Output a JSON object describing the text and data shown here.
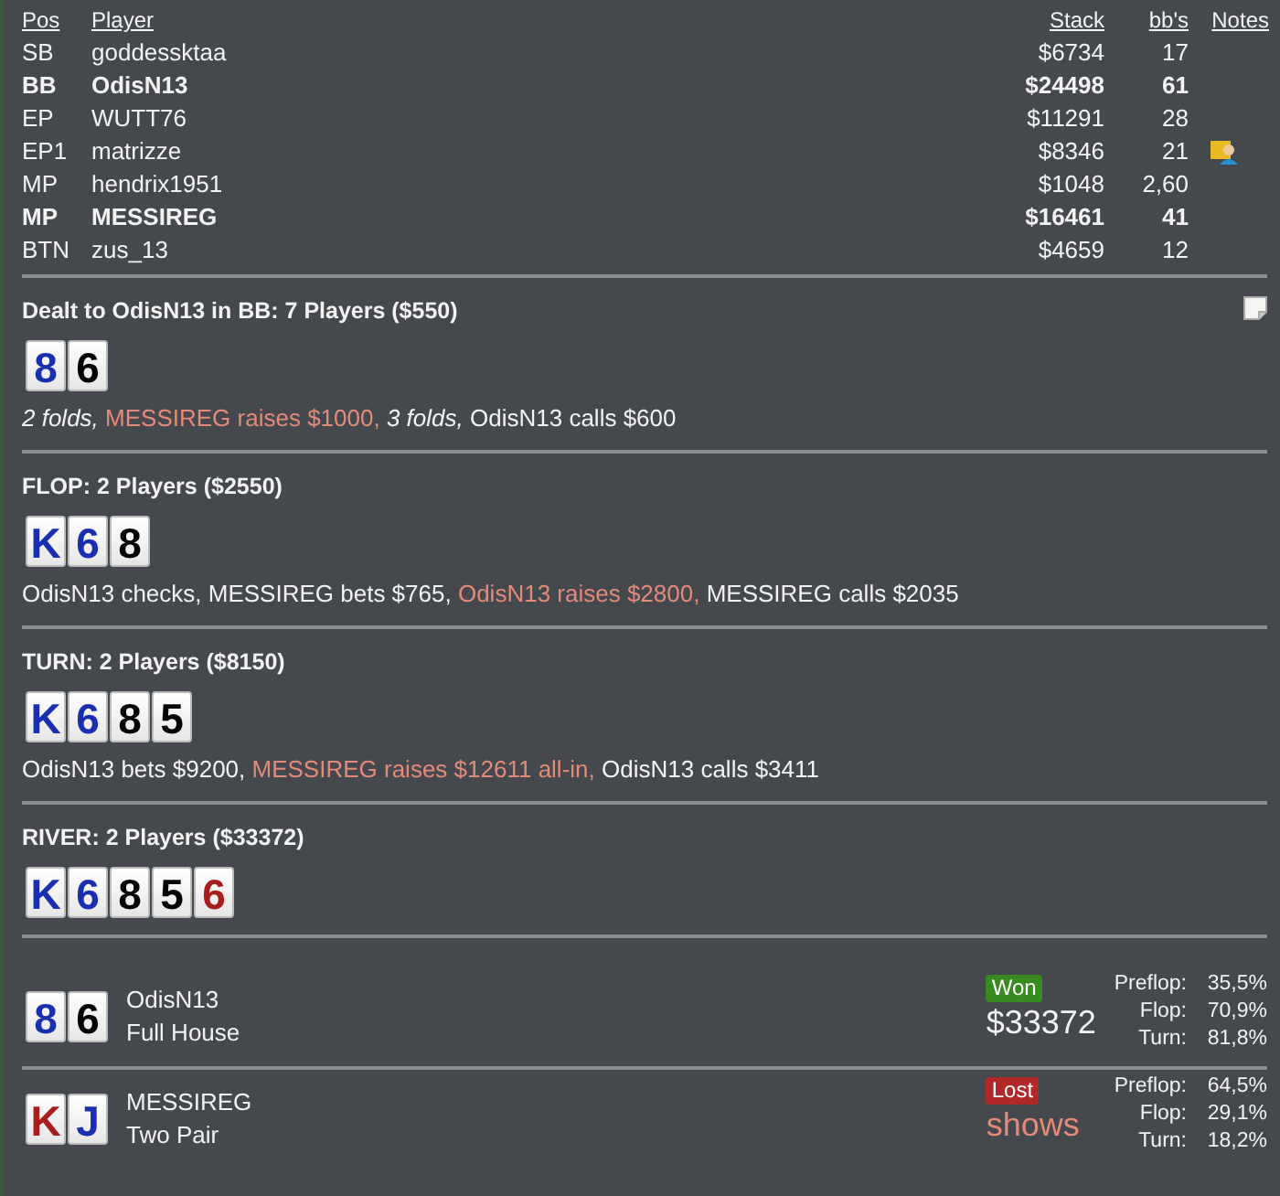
{
  "players": {
    "columns": [
      "Pos",
      "Player",
      "Stack",
      "bb's",
      "Notes"
    ],
    "rows": [
      {
        "pos": "SB",
        "name": "goddessktaa",
        "stack": "$6734",
        "bbs": "17",
        "bold": false,
        "note": false
      },
      {
        "pos": "BB",
        "name": "OdisN13",
        "stack": "$24498",
        "bbs": "61",
        "bold": true,
        "note": false
      },
      {
        "pos": "EP",
        "name": "WUTT76",
        "stack": "$11291",
        "bbs": "28",
        "bold": false,
        "note": false
      },
      {
        "pos": "EP1",
        "name": "matrizze",
        "stack": "$8346",
        "bbs": "21",
        "bold": false,
        "note": true
      },
      {
        "pos": "MP",
        "name": "hendrix1951",
        "stack": "$1048",
        "bbs": "2,60",
        "bold": false,
        "note": false
      },
      {
        "pos": "MP",
        "name": "MESSIREG",
        "stack": "$16461",
        "bbs": "41",
        "bold": true,
        "note": false
      },
      {
        "pos": "BTN",
        "name": "zus_13",
        "stack": "$4659",
        "bbs": "12",
        "bold": false,
        "note": false
      }
    ]
  },
  "streets": [
    {
      "title": "Dealt to OdisN13 in BB: 7 Players ($550)",
      "note_icon": true,
      "cards": [
        {
          "rank": "8",
          "color": "#1a2fb0"
        },
        {
          "rank": "6",
          "color": "#000000"
        }
      ],
      "actions": [
        {
          "text": "2 folds,",
          "kind": "folds"
        },
        {
          "text": "MESSIREG raises $1000,",
          "kind": "raise"
        },
        {
          "text": "3 folds,",
          "kind": "folds"
        },
        {
          "text": "OdisN13 calls $600",
          "kind": "plain"
        }
      ]
    },
    {
      "title": "FLOP: 2 Players ($2550)",
      "note_icon": false,
      "cards": [
        {
          "rank": "K",
          "color": "#1a2fb0"
        },
        {
          "rank": "6",
          "color": "#1a2fb0"
        },
        {
          "rank": "8",
          "color": "#000000"
        }
      ],
      "actions": [
        {
          "text": "OdisN13 checks,",
          "kind": "plain"
        },
        {
          "text": "MESSIREG bets $765,",
          "kind": "plain"
        },
        {
          "text": "OdisN13 raises $2800,",
          "kind": "raise"
        },
        {
          "text": "MESSIREG calls $2035",
          "kind": "plain"
        }
      ]
    },
    {
      "title": "TURN: 2 Players ($8150)",
      "note_icon": false,
      "cards": [
        {
          "rank": "K",
          "color": "#1a2fb0"
        },
        {
          "rank": "6",
          "color": "#1a2fb0"
        },
        {
          "rank": "8",
          "color": "#000000"
        },
        {
          "rank": "5",
          "color": "#000000"
        }
      ],
      "actions": [
        {
          "text": "OdisN13 bets $9200,",
          "kind": "plain"
        },
        {
          "text": "MESSIREG raises $12611 all-in,",
          "kind": "raise"
        },
        {
          "text": "OdisN13 calls $3411",
          "kind": "plain"
        }
      ]
    },
    {
      "title": "RIVER: 2 Players ($33372)",
      "note_icon": false,
      "cards": [
        {
          "rank": "K",
          "color": "#1a2fb0"
        },
        {
          "rank": "6",
          "color": "#1a2fb0"
        },
        {
          "rank": "8",
          "color": "#000000"
        },
        {
          "rank": "5",
          "color": "#000000"
        },
        {
          "rank": "6",
          "color": "#a81c1c"
        }
      ]
    }
  ],
  "results": [
    {
      "cards": [
        {
          "rank": "8",
          "color": "#1a2fb0"
        },
        {
          "rank": "6",
          "color": "#000000"
        }
      ],
      "name": "OdisN13",
      "hand": "Full House",
      "kind": "won",
      "badge": "Won",
      "amount": "$33372",
      "equity": [
        {
          "label": "Preflop:",
          "value": "35,5%"
        },
        {
          "label": "Flop:",
          "value": "70,9%"
        },
        {
          "label": "Turn:",
          "value": "81,8%"
        }
      ]
    },
    {
      "cards": [
        {
          "rank": "K",
          "color": "#a81c1c"
        },
        {
          "rank": "J",
          "color": "#1a2fb0"
        }
      ],
      "name": "MESSIREG",
      "hand": "Two Pair",
      "kind": "lost",
      "badge": "Lost",
      "amount": "shows",
      "equity": [
        {
          "label": "Preflop:",
          "value": "64,5%"
        },
        {
          "label": "Flop:",
          "value": "29,1%"
        },
        {
          "label": "Turn:",
          "value": "18,2%"
        }
      ]
    }
  ]
}
